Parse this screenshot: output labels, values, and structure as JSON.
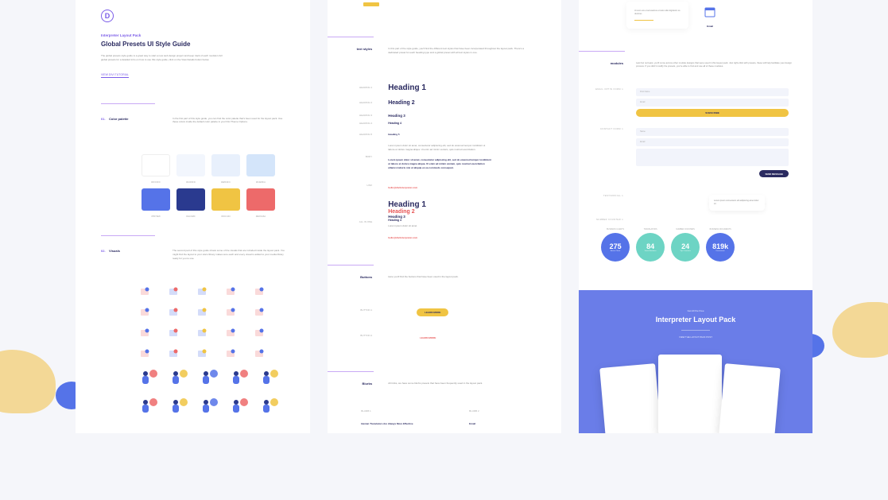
{
  "header": {
    "eyebrow": "Interpreter Layout Pack",
    "title": "Global Presets UI Style Guide",
    "desc": "The global presets style guide is a great way to start a new web design project and keep track of each module's full global presets for a detailed intro on how to use this style guide, click on the View Details button below.",
    "cta": "VIEW DIVI TUTORIAL"
  },
  "s01": {
    "num": "01.",
    "title": "Color palette",
    "desc": "In the first part of this style guide, you can find the color palette that's been used for the layout pack. Use these colors inside the default color palette in your Divi Theme Options."
  },
  "swatches": [
    {
      "hex": "#ffffff",
      "label": "#FFFFFF"
    },
    {
      "hex": "#f2f6fd",
      "label": "#F2F6FD"
    },
    {
      "hex": "#e8f0fc",
      "label": "#E8F0FC"
    },
    {
      "hex": "#d4e5fa",
      "label": "#D4E5FA"
    },
    {
      "hex": "#5573e8",
      "label": "#5573E8"
    },
    {
      "hex": "#2a3a8f",
      "label": "#2A3A8F"
    },
    {
      "hex": "#f0c443",
      "label": "#F0C443"
    },
    {
      "hex": "#ed6a6a",
      "label": "#ED6A6A"
    }
  ],
  "s02": {
    "num": "02.",
    "title": "Visuals",
    "desc": "The second part of this style guide shows some of the visuals that are included inside the layout pack. You might find the layout to your site's library makes sure each and every visual is added to your media library ready for you to use."
  },
  "c2": {
    "text_styles": {
      "label": "text styles",
      "desc": "In this part of the style guide, you'll find the different text styles that have been incorporated throughout the layout pack. There's a dedicated preset for each heading type and a global preset with all text styles in one."
    },
    "h": [
      "HEADING 1",
      "HEADING 2",
      "HEADING 3",
      "HEADING 4",
      "HEADING 5",
      "BODY",
      "LINK",
      "ALL IN ONE"
    ],
    "h1": "Heading 1",
    "h2": "Heading 2",
    "h3": "Heading 3",
    "h4": "Heading 4",
    "h5": "Heading 5",
    "body": "Lorem ipsum dolor sit amet, consectetur adipiscing elit, sed do eiusmod tempor incididunt ut labore et dolore magna aliqua. Ut enim ad minim veniam, quis nostrud exercitation.",
    "body_bold": "Lorem ipsum dolor sit amet, consectetur adipiscing elit, sed do eiusmod tempor incididunt ut labore et dolore magna aliqua. Ut enim ad minim veniam, quis nostrud exercitation ullamco laboris nisi ut aliquip ex ea commodo consequat.",
    "link": "hello@diviinterpreter.com",
    "buttons": {
      "label": "Buttons",
      "desc": "Here you'll find the buttons that have been used in the layout pack.",
      "b1": "BUTTON 1",
      "b2": "BUTTON 2",
      "learn": "LEARN MORE",
      "learn2": "LEARN MORE"
    },
    "blurbs": {
      "label": "Blurbs",
      "desc": "All tricks, we have some blurbs presets that have been frequently used in the layout pack.",
      "bl1": "BLURB 1",
      "bl2": "BLURB 2",
      "t1": "Human Translators Are Always More Effective",
      "t2": "Email"
    }
  },
  "c3": {
    "modules": {
      "label": "modules",
      "desc": "Last but not least, you'll come across other module designs that were used in this layout pack. Just right-click with presets, these will help facilitate your design process. If you didn't modify the presets, you're able to find and use all of these modules."
    },
    "card": "At vero eos et accusamus et iusto odio dignissim os ducimus",
    "card_label": "Email",
    "form1": "EMAIL OPTIN FORM 1",
    "form2": "CONTACT FORM 1",
    "inputs": {
      "name": "First Name",
      "email": "Email",
      "sub": "SUBSCRIBE",
      "cname": "Name",
      "cemail": "Email",
      "cmsg": "Message",
      "send": "SEND MESSAGE"
    },
    "testimonial": "TESTIMONIAL 1",
    "chat": "Lorem ipsum consectetur elit adipiscing amet dolor sit",
    "counter": "NUMBER COUNTER 1",
    "counters": [
      {
        "label": "BUSINESS CLIENTS",
        "num": "275",
        "sub": "Active Client",
        "color": "#5573e8"
      },
      {
        "label": "TRANSLATORS",
        "num": "84",
        "sub": "Team Members",
        "color": "#6dd4c4"
      },
      {
        "label": "NUMBER COUNTERS",
        "num": "24",
        "sub": "Top Countries",
        "color": "#6dd4c4"
      },
      {
        "label": "BUSINESS DOCUMENTS",
        "num": "819k",
        "sub": "Documents",
        "color": "#5573e8"
      }
    ],
    "promo": {
      "eyebrow": "Get All the Free",
      "title": "Interpreter Layout Pack",
      "sub": "VIEW THE LAYOUT PACK POST"
    }
  }
}
